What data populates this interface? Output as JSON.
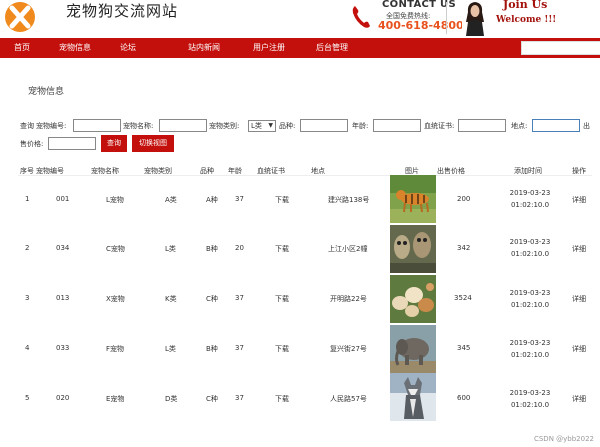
{
  "header": {
    "site_title": "宠物狗交流网站",
    "contact_title": "CONTACT US",
    "contact_sub": "全国免费热线:",
    "contact_phone": "400-618-4800",
    "join": "Join Us",
    "welcome": "Welcome !!!"
  },
  "nav": {
    "items": [
      "首页",
      "宠物信息",
      "论坛",
      "站内新闻",
      "用户注册",
      "后台管理"
    ]
  },
  "section_title": "宠物信息",
  "filters": {
    "query_label": "查询",
    "pet_id_label": "宠物编号:",
    "pet_name_label": "宠物名称:",
    "pet_type_label": "宠物类别:",
    "pet_type_value": "L类",
    "breed_label": "品种:",
    "age_label": "年龄:",
    "pedigree_label": "血统证书:",
    "location_label": "地点:",
    "price_label_1": "出",
    "price_label_2": "售价格:",
    "search_button": "查询",
    "switch_view_button": "切换视图"
  },
  "table": {
    "headers": [
      "序号",
      "宠物编号",
      "宠物名称",
      "宠物类别",
      "品种",
      "年龄",
      "血统证书",
      "地点",
      "图片",
      "出售价格",
      "添加时间",
      "操作"
    ],
    "rows": [
      {
        "idx": "1",
        "id": "001",
        "name": "L宠物",
        "type": "A类",
        "breed": "A种",
        "age": "37",
        "cert": "下载",
        "location": "建兴路138号",
        "price": "200",
        "date": "2019-03-23",
        "time": "01:02:10.0",
        "action": "详细"
      },
      {
        "idx": "2",
        "id": "034",
        "name": "C宠物",
        "type": "L类",
        "breed": "B种",
        "age": "20",
        "cert": "下载",
        "location": "上江小区2幢",
        "price": "342",
        "date": "2019-03-23",
        "time": "01:02:10.0",
        "action": "详细"
      },
      {
        "idx": "3",
        "id": "013",
        "name": "X宠物",
        "type": "K类",
        "breed": "C种",
        "age": "37",
        "cert": "下载",
        "location": "开明路22号",
        "price": "3524",
        "date": "2019-03-23",
        "time": "01:02:10.0",
        "action": "详细"
      },
      {
        "idx": "4",
        "id": "033",
        "name": "F宠物",
        "type": "L类",
        "breed": "B种",
        "age": "37",
        "cert": "下载",
        "location": "复兴街27号",
        "price": "345",
        "date": "2019-03-23",
        "time": "01:02:10.0",
        "action": "详细"
      },
      {
        "idx": "5",
        "id": "020",
        "name": "E宠物",
        "type": "D类",
        "breed": "C种",
        "age": "37",
        "cert": "下载",
        "location": "人民路57号",
        "price": "600",
        "date": "2019-03-23",
        "time": "01:02:10.0",
        "action": "详细"
      }
    ]
  },
  "watermark": "CSDN @ybb2022",
  "colors": {
    "brand_red": "#c3100c",
    "contact_orange": "#e8521f",
    "join_red": "#a3120c"
  },
  "images": [
    "tiger-photo",
    "owls-photo",
    "sheep-photo",
    "elephant-photo",
    "wolf-photo"
  ]
}
